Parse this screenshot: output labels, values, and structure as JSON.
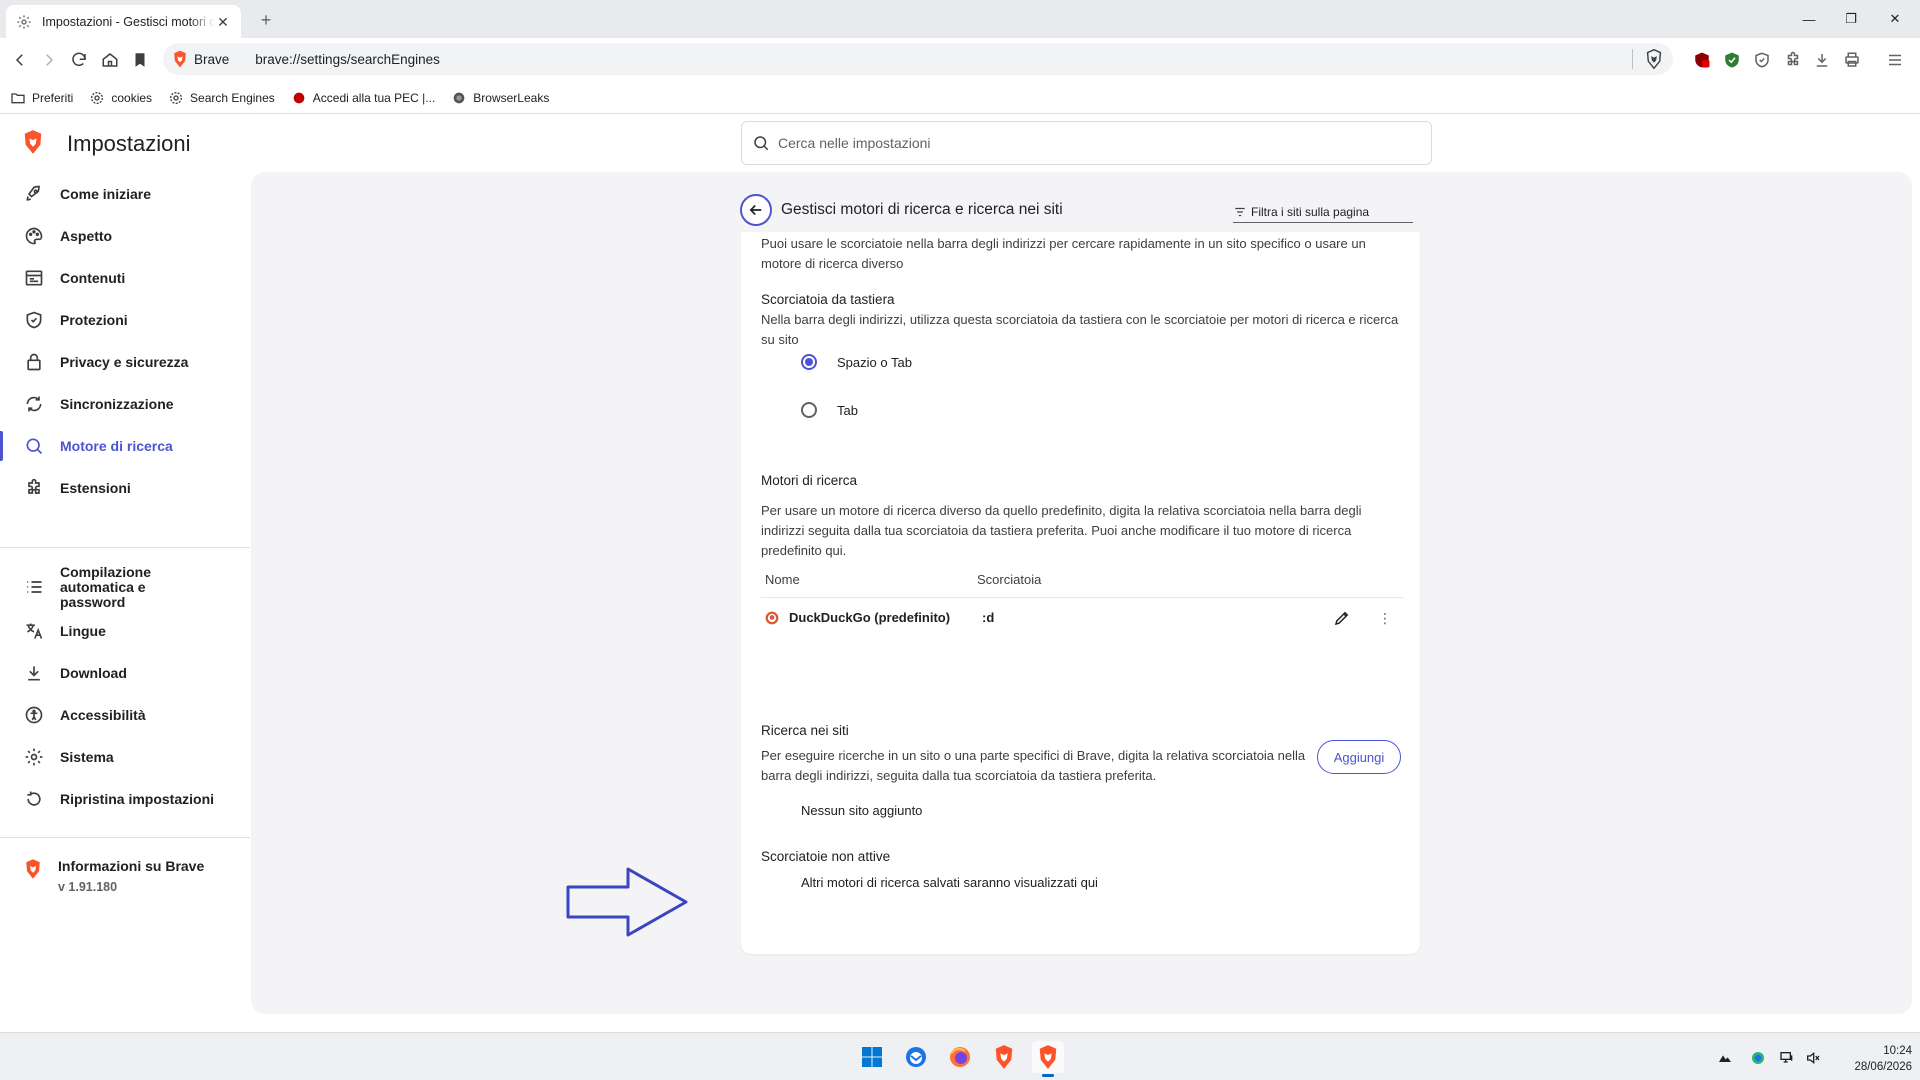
{
  "browser": {
    "tab_title": "Impostazioni - Gestisci motori di ricerca e ricerca nei siti",
    "site_label": "Brave",
    "url": "brave://settings/searchEngines",
    "bookmarks": [
      {
        "label": "Preferiti",
        "icon": "folder-icon"
      },
      {
        "label": "cookies",
        "icon": "gear-icon"
      },
      {
        "label": "Search Engines",
        "icon": "gear-icon"
      },
      {
        "label": "Accedi alla tua PEC |...",
        "icon": "red-dot-icon"
      },
      {
        "label": "BrowserLeaks",
        "icon": "browserleaks-icon"
      }
    ]
  },
  "settings": {
    "heading": "Impostazioni",
    "search_placeholder": "Cerca nelle impostazioni",
    "nav": [
      {
        "label": "Come iniziare",
        "icon": "rocket-icon"
      },
      {
        "label": "Aspetto",
        "icon": "palette-icon"
      },
      {
        "label": "Contenuti",
        "icon": "content-icon"
      },
      {
        "label": "Protezioni",
        "icon": "shield-icon"
      },
      {
        "label": "Privacy e sicurezza",
        "icon": "lock-icon"
      },
      {
        "label": "Sincronizzazione",
        "icon": "sync-icon"
      },
      {
        "label": "Motore di ricerca",
        "icon": "search-icon",
        "active": true
      },
      {
        "label": "Estensioni",
        "icon": "puzzle-icon"
      }
    ],
    "nav2": [
      {
        "label": "Compilazione automatica e password",
        "icon": "list-icon"
      },
      {
        "label": "Lingue",
        "icon": "translate-icon"
      },
      {
        "label": "Download",
        "icon": "download-icon"
      },
      {
        "label": "Accessibilità",
        "icon": "accessibility-icon"
      },
      {
        "label": "Sistema",
        "icon": "gear-icon"
      },
      {
        "label": "Ripristina impostazioni",
        "icon": "reset-icon"
      }
    ],
    "about": {
      "title": "Informazioni su Brave",
      "version": "v 1.91.180"
    }
  },
  "page": {
    "title": "Gestisci motori di ricerca e ricerca nei siti",
    "filter_placeholder": "Filtra i siti sulla pagina",
    "intro_1": "Puoi usare le scorciatoie nella barra degli indirizzi per cercare rapidamente in un sito specifico o usare un",
    "intro_2": "motore di ricerca diverso",
    "keyboard_title": "Scorciatoia da tastiera",
    "keyboard_desc_1": "Nella barra degli indirizzi, utilizza questa scorciatoia da tastiera con le scorciatoie per motori di ricerca e ricerca",
    "keyboard_desc_2": "su sito",
    "radio_1": "Spazio o Tab",
    "radio_2": "Tab",
    "engines_title": "Motori di ricerca",
    "engines_desc_1": "Per usare un motore di ricerca diverso da quello predefinito, digita la relativa scorciatoia nella barra degli",
    "engines_desc_2": "indirizzi seguita dalla tua scorciatoia da tastiera preferita. Puoi anche modificare il tuo motore di ricerca",
    "engines_desc_3": "predefinito qui.",
    "col_name": "Nome",
    "col_shortcut": "Scorciatoia",
    "engine_name": "DuckDuckGo (predefinito)",
    "engine_shortcut": ":d",
    "site_title": "Ricerca nei siti",
    "site_desc_1": "Per eseguire ricerche in un sito o una parte specifici di Brave, digita la relativa scorciatoia nella",
    "site_desc_2": "barra degli indirizzi, seguita dalla tua scorciatoia da tastiera preferita.",
    "add_label": "Aggiungi",
    "no_sites": "Nessun sito aggiunto",
    "inactive_title": "Scorciatoie non attive",
    "inactive_desc": "Altri motori di ricerca salvati saranno visualizzati qui"
  },
  "taskbar": {
    "time": "10:24",
    "date": "28/06/2026"
  },
  "colors": {
    "accent": "#4c54d2",
    "brave_orange": "#fb542b",
    "annotation_arrow": "#3a45c4"
  }
}
